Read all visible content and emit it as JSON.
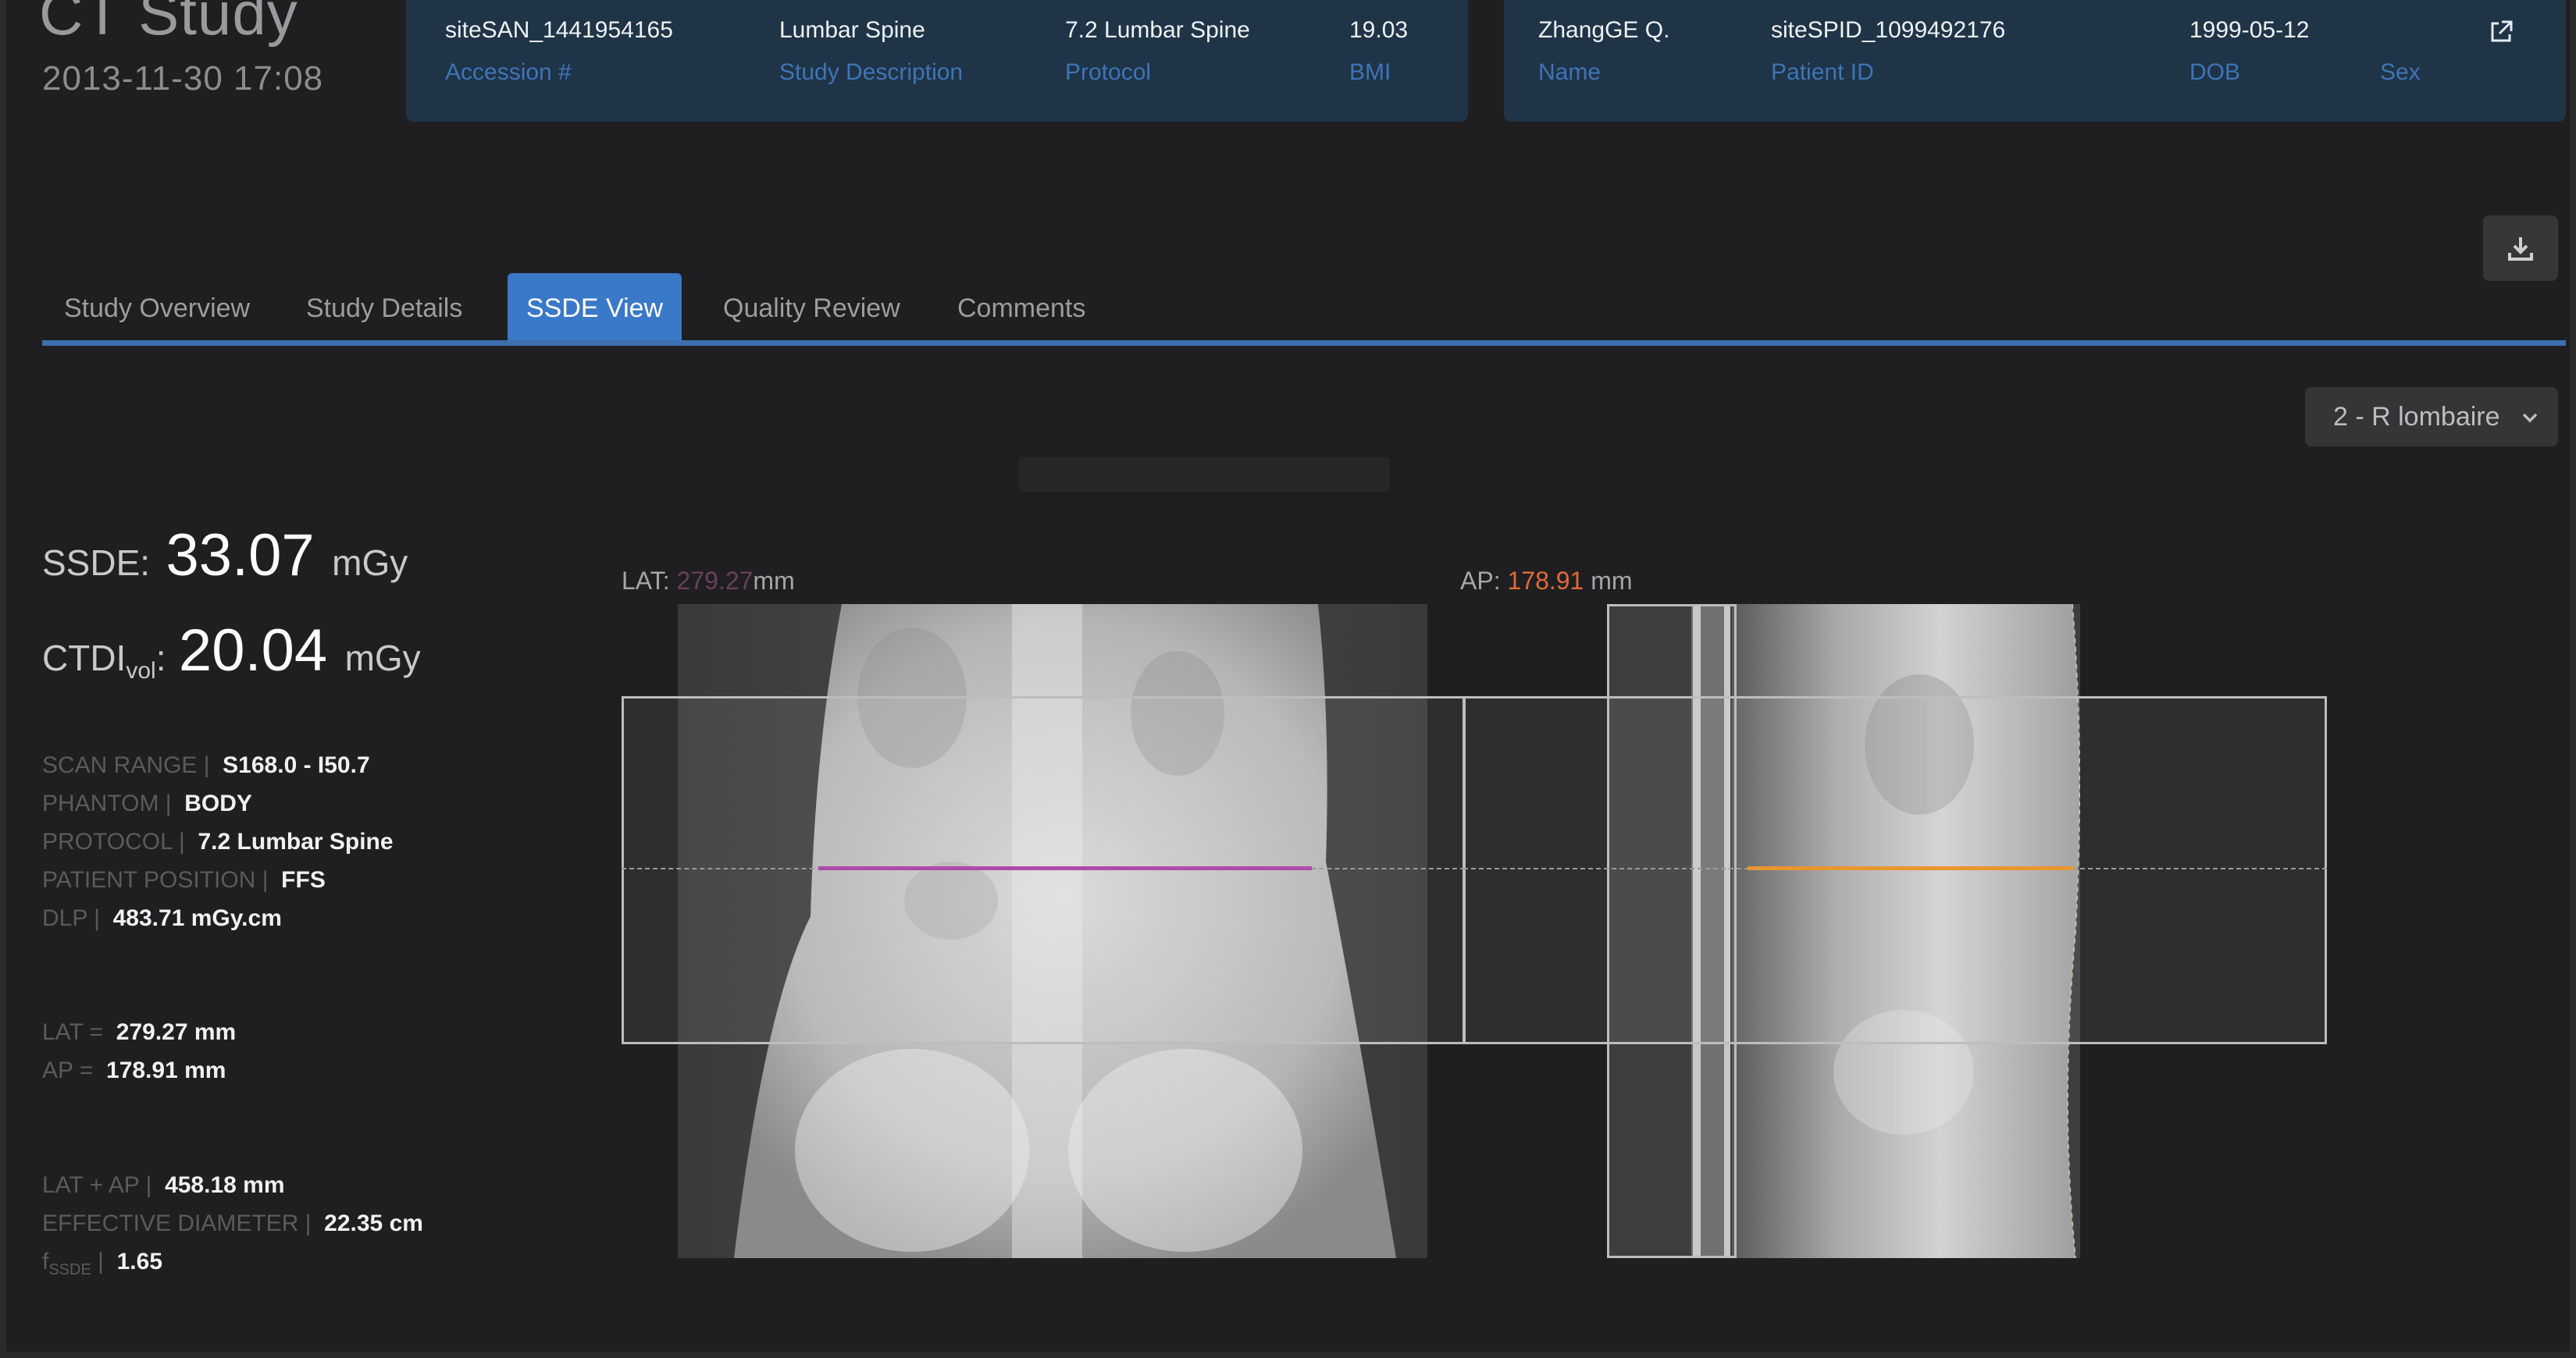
{
  "study": {
    "title": "CT Study",
    "datetime": "2013-11-30 17:08"
  },
  "study_info": {
    "values": [
      "siteSAN_1441954165",
      "Lumbar Spine",
      "7.2 Lumbar Spine",
      "19.03"
    ],
    "labels": [
      "Accession #",
      "Study Description",
      "Protocol",
      "BMI"
    ]
  },
  "patient_info": {
    "values": [
      "ZhangGE Q.",
      "siteSPID_1099492176",
      "1999-05-12",
      ""
    ],
    "labels": [
      "Name",
      "Patient ID",
      "DOB",
      "Sex"
    ]
  },
  "tabs": [
    "Study Overview",
    "Study Details",
    "SSDE View",
    "Quality Review",
    "Comments"
  ],
  "active_tab": "SSDE View",
  "region_select": {
    "value": "2 - R lombaire"
  },
  "metrics": {
    "ssde": {
      "label": "SSDE:",
      "value": "33.07",
      "unit": "mGy"
    },
    "ctdi": {
      "label_main": "CTDI",
      "label_sub": "vol",
      "label_colon": ":",
      "value": "20.04",
      "unit": "mGy"
    },
    "details": [
      {
        "key": "SCAN RANGE |",
        "value": "S168.0 - I50.7"
      },
      {
        "key": "PHANTOM |",
        "value": "BODY"
      },
      {
        "key": "PROTOCOL |",
        "value": "7.2 Lumbar Spine"
      },
      {
        "key": "PATIENT POSITION |",
        "value": "FFS"
      },
      {
        "key": "DLP |",
        "value": "483.71 mGy.cm"
      }
    ],
    "dims": [
      {
        "key": "LAT =",
        "value": "279.27 mm"
      },
      {
        "key": "AP =",
        "value": "178.91 mm"
      }
    ],
    "derived": [
      {
        "key": "LAT + AP |",
        "value": "458.18 mm"
      },
      {
        "key": "EFFECTIVE DIAMETER |",
        "value": "22.35 cm"
      }
    ],
    "fssde": {
      "key_main": "f",
      "key_sub": "SSDE",
      "key_sep": " |",
      "value": "1.65"
    }
  },
  "images": {
    "lat": {
      "label": "LAT:",
      "value": "279.27",
      "unit": "mm",
      "line_color": "#b04aa8"
    },
    "ap": {
      "label": "AP:",
      "value": "178.91",
      "unit": "mm",
      "line_color": "#e8962e"
    }
  },
  "colors": {
    "accent": "#3a78c8",
    "header_bg": "#1f3447",
    "header_label": "#3f74b7",
    "ap_value": "#e06a38"
  },
  "icons": {
    "external_link": "external-link-icon",
    "download": "download-icon",
    "dropdown": "chevron-down-icon"
  }
}
